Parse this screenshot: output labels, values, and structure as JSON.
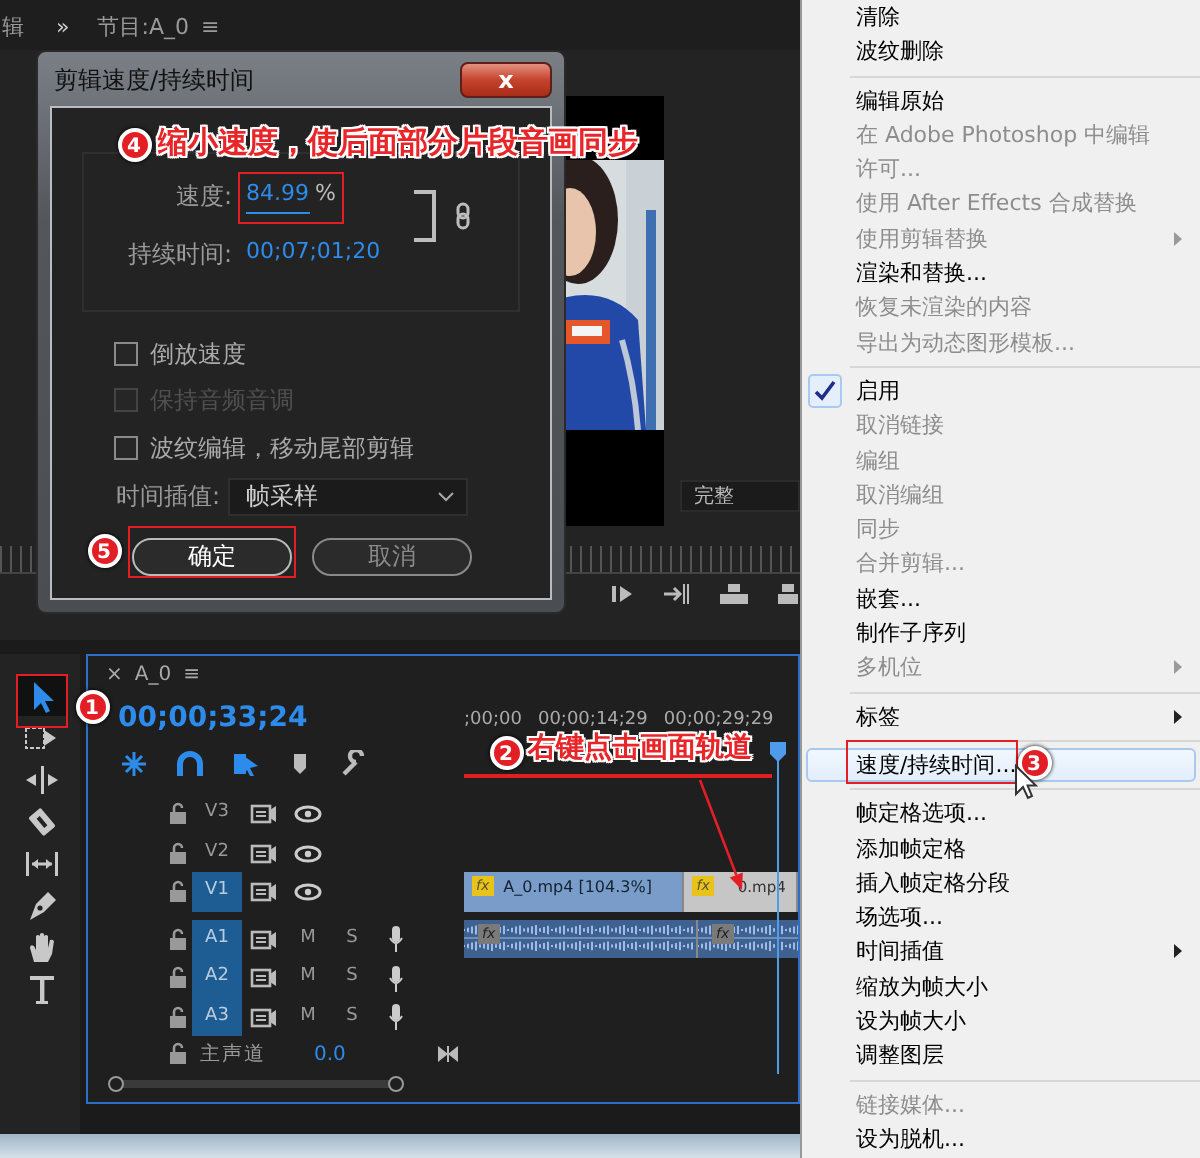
{
  "top_bar": {
    "cut_label": "辑",
    "overflow": "»",
    "panel_title": "节目:A_0",
    "panel_menu": "≡"
  },
  "program_monitor": {
    "zoom": "完整"
  },
  "dialog": {
    "title": "剪辑速度/持续时间",
    "close": "x",
    "speed_label": "速度:",
    "speed_value": "84.99",
    "speed_unit": "%",
    "duration_label": "持续时间:",
    "duration_value": "00;07;01;20",
    "options": [
      {
        "label": "倒放速度",
        "checked": false,
        "disabled": false
      },
      {
        "label": "保持音频音调",
        "checked": false,
        "disabled": true
      },
      {
        "label": "波纹编辑，移动尾部剪辑",
        "checked": false,
        "disabled": false
      }
    ],
    "interpolation_label": "时间插值:",
    "interpolation_value": "帧采样",
    "buttons": [
      {
        "label": "确定",
        "kind": "default"
      },
      {
        "label": "取消",
        "kind": "normal"
      }
    ]
  },
  "tools": [
    {
      "kind": "selection",
      "selected": true
    },
    {
      "kind": "track-select",
      "selected": false
    },
    {
      "kind": "ripple",
      "selected": false
    },
    {
      "kind": "razor",
      "selected": false
    },
    {
      "kind": "slip",
      "selected": false
    },
    {
      "kind": "pen",
      "selected": false
    },
    {
      "kind": "hand",
      "selected": false
    },
    {
      "kind": "type",
      "selected": false
    }
  ],
  "timeline": {
    "close": "×",
    "sequence": "A_0",
    "panel_menu": "≡",
    "timecode": "00;00;33;24",
    "ruler_labels": [
      ";00;00",
      "00;00;14;29",
      "00;00;29;29"
    ],
    "tracks": [
      {
        "kind": "video",
        "name": "V3",
        "targeted": false
      },
      {
        "kind": "video",
        "name": "V2",
        "targeted": false
      },
      {
        "kind": "video",
        "name": "V1",
        "targeted": true,
        "clips": [
          {
            "badge": "fx",
            "label": "A_0.mp4 [104.3%]",
            "selected": true
          },
          {
            "badge": "fx",
            "label": "0.mp4",
            "selected": false
          }
        ]
      },
      {
        "kind": "audio",
        "name": "A1",
        "targeted": true,
        "mute": "M",
        "solo": "S",
        "clips": [
          {
            "badge": "fx"
          },
          {
            "badge": "fx"
          }
        ]
      },
      {
        "kind": "audio",
        "name": "A2",
        "targeted": true,
        "mute": "M",
        "solo": "S"
      },
      {
        "kind": "audio",
        "name": "A3",
        "targeted": true,
        "mute": "M",
        "solo": "S"
      }
    ],
    "master": {
      "name": "主声道",
      "value": "0.0"
    }
  },
  "context_menu": {
    "items": [
      {
        "kind": "item",
        "label": "清除",
        "disabled": false,
        "checked": false,
        "submenu": false,
        "highlighted": false
      },
      {
        "kind": "item",
        "label": "波纹删除",
        "disabled": false,
        "checked": false,
        "submenu": false,
        "highlighted": false
      },
      {
        "kind": "separator"
      },
      {
        "kind": "item",
        "label": "编辑原始",
        "disabled": false,
        "checked": false,
        "submenu": false,
        "highlighted": false
      },
      {
        "kind": "item",
        "label": "在 Adobe Photoshop 中编辑",
        "disabled": true,
        "checked": false,
        "submenu": false,
        "highlighted": false
      },
      {
        "kind": "item",
        "label": "许可...",
        "disabled": true,
        "checked": false,
        "submenu": false,
        "highlighted": false
      },
      {
        "kind": "item",
        "label": "使用 After Effects 合成替换",
        "disabled": true,
        "checked": false,
        "submenu": false,
        "highlighted": false
      },
      {
        "kind": "item",
        "label": "使用剪辑替换",
        "disabled": true,
        "checked": false,
        "submenu": true,
        "highlighted": false
      },
      {
        "kind": "item",
        "label": "渲染和替换...",
        "disabled": false,
        "checked": false,
        "submenu": false,
        "highlighted": false
      },
      {
        "kind": "item",
        "label": "恢复未渲染的内容",
        "disabled": true,
        "checked": false,
        "submenu": false,
        "highlighted": false
      },
      {
        "kind": "item",
        "label": "导出为动态图形模板...",
        "disabled": true,
        "checked": false,
        "submenu": false,
        "highlighted": false
      },
      {
        "kind": "separator"
      },
      {
        "kind": "item",
        "label": "启用",
        "disabled": false,
        "checked": true,
        "submenu": false,
        "highlighted": false
      },
      {
        "kind": "item",
        "label": "取消链接",
        "disabled": true,
        "checked": false,
        "submenu": false,
        "highlighted": false
      },
      {
        "kind": "item",
        "label": "编组",
        "disabled": true,
        "checked": false,
        "submenu": false,
        "highlighted": false
      },
      {
        "kind": "item",
        "label": "取消编组",
        "disabled": true,
        "checked": false,
        "submenu": false,
        "highlighted": false
      },
      {
        "kind": "item",
        "label": "同步",
        "disabled": true,
        "checked": false,
        "submenu": false,
        "highlighted": false
      },
      {
        "kind": "item",
        "label": "合并剪辑...",
        "disabled": true,
        "checked": false,
        "submenu": false,
        "highlighted": false
      },
      {
        "kind": "item",
        "label": "嵌套...",
        "disabled": false,
        "checked": false,
        "submenu": false,
        "highlighted": false
      },
      {
        "kind": "item",
        "label": "制作子序列",
        "disabled": false,
        "checked": false,
        "submenu": false,
        "highlighted": false
      },
      {
        "kind": "item",
        "label": "多机位",
        "disabled": true,
        "checked": false,
        "submenu": true,
        "highlighted": false
      },
      {
        "kind": "separator"
      },
      {
        "kind": "item",
        "label": "标签",
        "disabled": false,
        "checked": false,
        "submenu": true,
        "highlighted": false
      },
      {
        "kind": "separator"
      },
      {
        "kind": "item",
        "label": "速度/持续时间...",
        "disabled": false,
        "checked": false,
        "submenu": false,
        "highlighted": true
      },
      {
        "kind": "separator"
      },
      {
        "kind": "item",
        "label": "帧定格选项...",
        "disabled": false,
        "checked": false,
        "submenu": false,
        "highlighted": false
      },
      {
        "kind": "item",
        "label": "添加帧定格",
        "disabled": false,
        "checked": false,
        "submenu": false,
        "highlighted": false
      },
      {
        "kind": "item",
        "label": "插入帧定格分段",
        "disabled": false,
        "checked": false,
        "submenu": false,
        "highlighted": false
      },
      {
        "kind": "item",
        "label": "场选项...",
        "disabled": false,
        "checked": false,
        "submenu": false,
        "highlighted": false
      },
      {
        "kind": "item",
        "label": "时间插值",
        "disabled": false,
        "checked": false,
        "submenu": true,
        "highlighted": false
      },
      {
        "kind": "item",
        "label": "缩放为帧大小",
        "disabled": false,
        "checked": false,
        "submenu": false,
        "highlighted": false
      },
      {
        "kind": "item",
        "label": "设为帧大小",
        "disabled": false,
        "checked": false,
        "submenu": false,
        "highlighted": false
      },
      {
        "kind": "item",
        "label": "调整图层",
        "disabled": false,
        "checked": false,
        "submenu": false,
        "highlighted": false
      },
      {
        "kind": "separator"
      },
      {
        "kind": "item",
        "label": "链接媒体...",
        "disabled": true,
        "checked": false,
        "submenu": false,
        "highlighted": false
      },
      {
        "kind": "item",
        "label": "设为脱机...",
        "disabled": false,
        "checked": false,
        "submenu": false,
        "highlighted": false
      }
    ]
  },
  "annotations": [
    {
      "number": "1",
      "framed": true,
      "arrow": false
    },
    {
      "number": "2",
      "text": "右键点击画面轨道",
      "framed": false,
      "arrow": true
    },
    {
      "number": "3",
      "framed": true,
      "arrow": false
    },
    {
      "number": "4",
      "text": "缩小速度，使后面部分片段音画同步",
      "framed": true,
      "arrow": false
    },
    {
      "number": "5",
      "framed": true,
      "arrow": false
    }
  ]
}
